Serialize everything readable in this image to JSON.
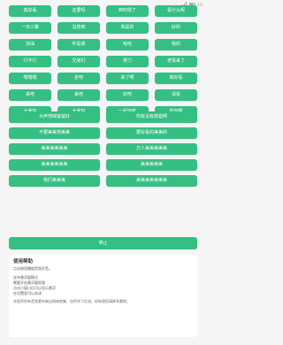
{
  "status_bar": {
    "time": "13"
  },
  "grid_buttons": [
    "真好看",
    "还要吗",
    "到时候了",
    "看什么呢",
    "一日三餐",
    "没想到",
    "真是的",
    "好的",
    "加油",
    "你是谁",
    "哈哈",
    "我的",
    "行不行",
    "兄弟们",
    "努力",
    "老铁来了",
    "嘿嘿嘿",
    "走吧",
    "来了啊",
    "真好看",
    "来吧",
    "来吧",
    "好吧",
    "请看",
    "大家好",
    "大家好",
    "一起不吃",
    "你好啊"
  ],
  "wide_buttons": [
    "大声地喊爸爸好",
    "你有没有搞错啊",
    "不要美美地美美",
    "要好看的美美的",
    "美美美美美美",
    "万人美美美美美",
    "美美美美美美",
    "美美美美美",
    "我们美美美",
    "美美美美美美美"
  ],
  "stop_button": "停止",
  "help": {
    "title": "使用帮助",
    "lines_1": [
      "点击按钮播放音效声音。"
    ],
    "lines_2": [
      "支持悬浮窗模式",
      "需要开启悬浮窗权限",
      "点击小窗口后可以显示悬浮",
      "在设置里可以关闭"
    ],
    "note": "本程序所有音效素材来自网络收集，仅供学习交流，如有侵权请联系删除。"
  },
  "colors": {
    "button": "#35bf83",
    "background": "#f4f5f4"
  }
}
